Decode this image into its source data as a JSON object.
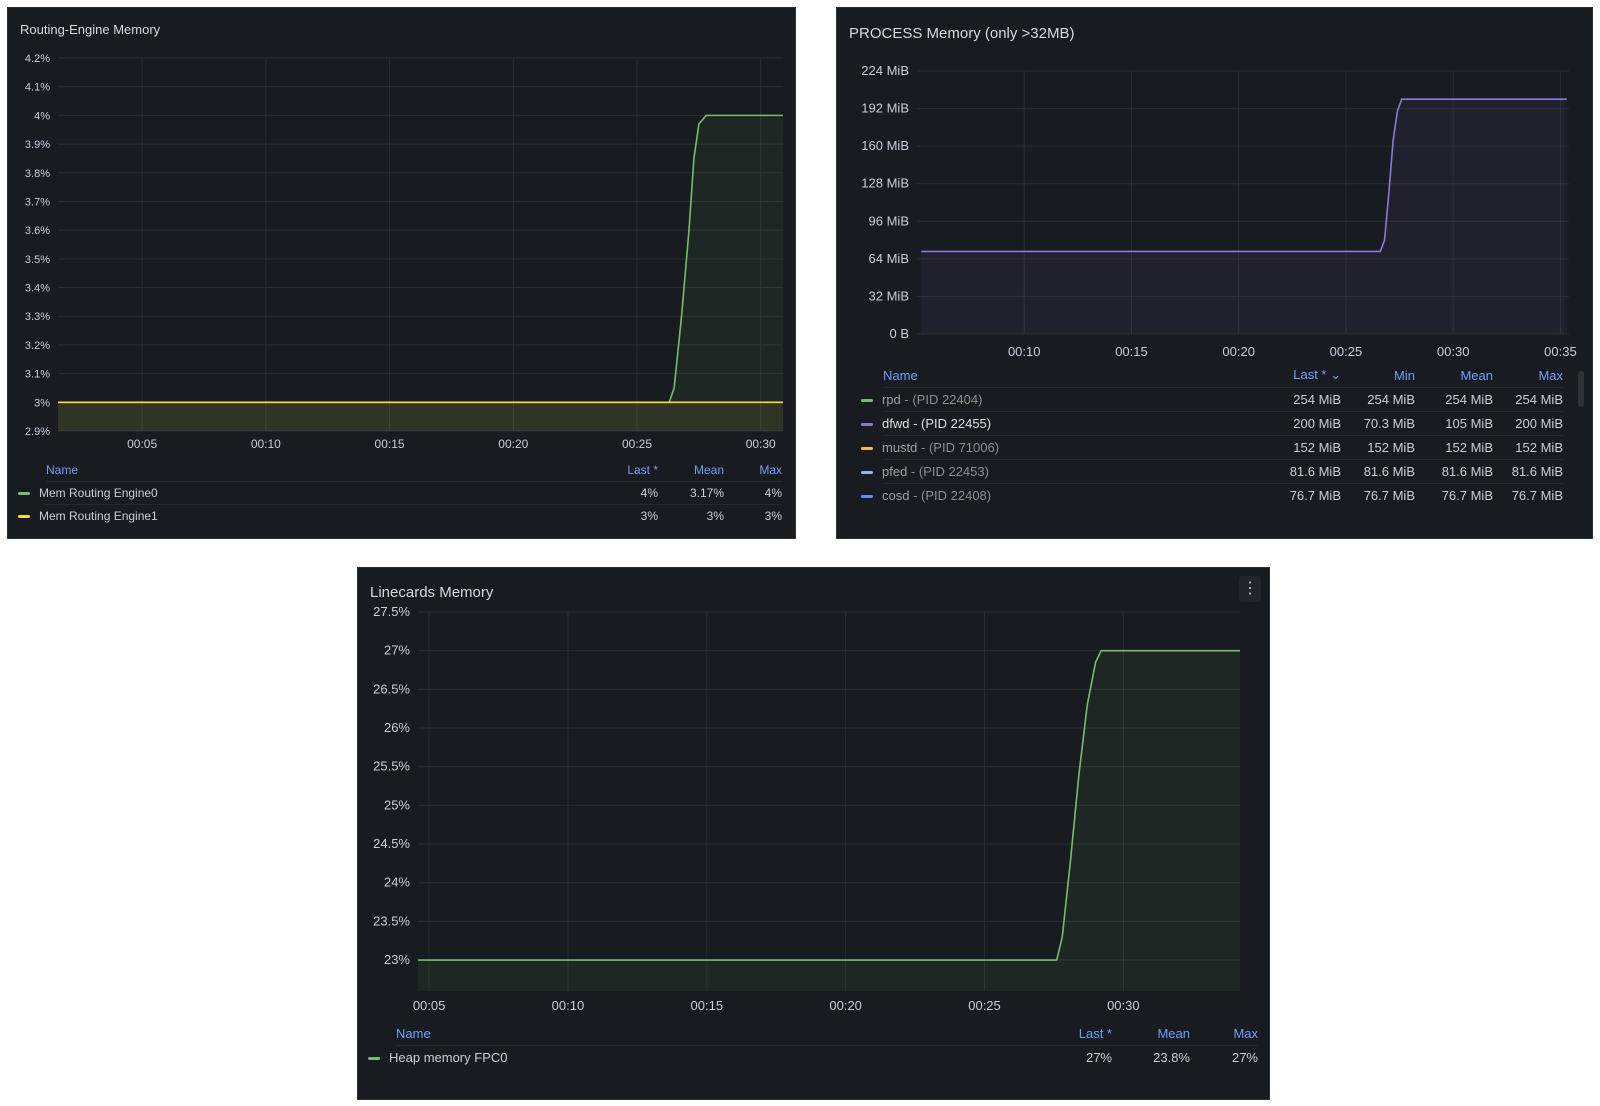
{
  "panels": {
    "routing": {
      "title": "Routing-Engine Memory",
      "legend": {
        "headers": [
          "Name",
          "Last *",
          "Mean",
          "Max"
        ],
        "rows": [
          {
            "name": "Mem Routing Engine0",
            "last": "4%",
            "mean": "3.17%",
            "max": "4%",
            "color": "#73bf69"
          },
          {
            "name": "Mem Routing Engine1",
            "last": "3%",
            "mean": "3%",
            "max": "3%",
            "color": "#fade2a"
          }
        ]
      }
    },
    "process": {
      "title": "PROCESS Memory (only >32MB)",
      "legend": {
        "headers": [
          "Name",
          "Last * ⌄",
          "Min",
          "Mean",
          "Max"
        ],
        "rows": [
          {
            "name": "rpd",
            "pid": " - (PID 22404)",
            "last": "254 MiB",
            "min": "254 MiB",
            "mean": "254 MiB",
            "max": "254 MiB",
            "color": "#73bf69"
          },
          {
            "name": "dfwd",
            "pid": " - (PID 22455)",
            "last": "200 MiB",
            "min": "70.3 MiB",
            "mean": "105 MiB",
            "max": "200 MiB",
            "color": "#8f78d8"
          },
          {
            "name": "mustd",
            "pid": " - (PID 71006)",
            "last": "152 MiB",
            "min": "152 MiB",
            "mean": "152 MiB",
            "max": "152 MiB",
            "color": "#ffb357"
          },
          {
            "name": "pfed",
            "pid": " - (PID 22453)",
            "last": "81.6 MiB",
            "min": "81.6 MiB",
            "mean": "81.6 MiB",
            "max": "81.6 MiB",
            "color": "#8ab8ff"
          },
          {
            "name": "cosd",
            "pid": " - (PID 22408)",
            "last": "76.7 MiB",
            "min": "76.7 MiB",
            "mean": "76.7 MiB",
            "max": "76.7 MiB",
            "color": "#5794f2"
          }
        ]
      }
    },
    "linecards": {
      "title": "Linecards Memory",
      "menu_icon": "⋮",
      "legend": {
        "headers": [
          "Name",
          "Last *",
          "Mean",
          "Max"
        ],
        "rows": [
          {
            "name": "Heap memory FPC0",
            "last": "27%",
            "mean": "23.8%",
            "max": "27%",
            "color": "#73bf69"
          }
        ]
      }
    }
  },
  "chart_data": [
    {
      "type": "line",
      "title": "Routing-Engine Memory",
      "x_ticks": [
        "00:05",
        "00:10",
        "00:15",
        "00:20",
        "00:25",
        "00:30"
      ],
      "y_ticks": [
        "2.9%",
        "3%",
        "3.1%",
        "3.2%",
        "3.3%",
        "3.4%",
        "3.5%",
        "3.6%",
        "3.7%",
        "3.8%",
        "3.9%",
        "4%",
        "4.1%",
        "4.2%"
      ],
      "ylim": [
        2.9,
        4.2
      ],
      "xlim_min": [
        1.6,
        30.9
      ],
      "series": [
        {
          "name": "Mem Routing Engine0",
          "color": "#73bf69",
          "x_min": [
            1.6,
            26.3,
            26.5,
            26.8,
            27.1,
            27.3,
            27.5,
            27.8,
            30.9
          ],
          "values": [
            3.0,
            3.0,
            3.05,
            3.3,
            3.6,
            3.85,
            3.97,
            4.0,
            4.0
          ]
        },
        {
          "name": "Mem Routing Engine1",
          "color": "#fade2a",
          "x_min": [
            1.6,
            30.9
          ],
          "values": [
            3.0,
            3.0
          ]
        }
      ],
      "grid": true,
      "legend": "bottom"
    },
    {
      "type": "line",
      "title": "PROCESS Memory (only >32MB)",
      "x_ticks": [
        "00:10",
        "00:15",
        "00:20",
        "00:25",
        "00:30",
        "00:35"
      ],
      "y_ticks": [
        "0 B",
        "32 MiB",
        "64 MiB",
        "96 MiB",
        "128 MiB",
        "160 MiB",
        "192 MiB",
        "224 MiB"
      ],
      "ylim": [
        0,
        224
      ],
      "xlim_min": [
        5.0,
        35.4
      ],
      "series": [
        {
          "name": "dfwd - (PID 22455)",
          "color": "#8f78d8",
          "x_min": [
            5.2,
            26.6,
            26.8,
            27.0,
            27.2,
            27.4,
            27.6,
            35.3
          ],
          "values": [
            70.3,
            70.3,
            80,
            120,
            165,
            190,
            200,
            200
          ]
        }
      ],
      "grid": true,
      "legend": "bottom"
    },
    {
      "type": "line",
      "title": "Linecards Memory",
      "x_ticks": [
        "00:05",
        "00:10",
        "00:15",
        "00:20",
        "00:25",
        "00:30"
      ],
      "y_ticks": [
        "23%",
        "23.5%",
        "24%",
        "24.5%",
        "25%",
        "25.5%",
        "26%",
        "26.5%",
        "27%",
        "27.5%"
      ],
      "ylim": [
        22.6,
        27.5
      ],
      "xlim_min": [
        4.6,
        34.2
      ],
      "series": [
        {
          "name": "Heap memory FPC0",
          "color": "#73bf69",
          "x_min": [
            4.6,
            27.6,
            27.8,
            28.1,
            28.4,
            28.7,
            29.0,
            29.2,
            34.2
          ],
          "values": [
            23.0,
            23.0,
            23.3,
            24.3,
            25.4,
            26.3,
            26.85,
            27.0,
            27.0
          ]
        }
      ],
      "grid": true,
      "legend": "bottom"
    }
  ]
}
